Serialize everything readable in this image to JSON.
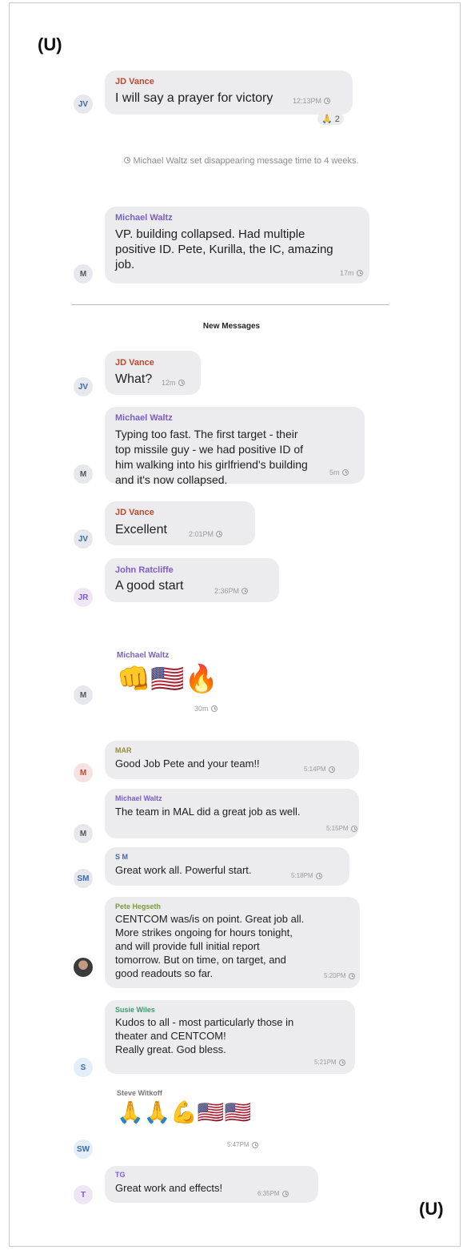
{
  "classification": "(U)",
  "colors": {
    "bubble": "#ececee",
    "jd_vance": "#c0482e",
    "michael_waltz": "#7b5ec8",
    "john_ratcliffe": "#7b5ec8",
    "mar": "#9a8a3c",
    "sm": "#3f6aa8",
    "pete_hegseth": "#7a9a3c",
    "susie_wiles": "#3c9a70",
    "steve_witkoff": "#777777",
    "tg": "#7b5ec8"
  },
  "system_message": "Michael Waltz set disappearing message time to 4 weeks.",
  "new_messages_label": "New Messages",
  "messages": [
    {
      "sender": "JD Vance",
      "avatar": "JV",
      "text": [
        "I will say a prayer for victory"
      ],
      "time": "12:13PM",
      "reaction": {
        "emoji": "🙏",
        "count": "2"
      }
    },
    {
      "sender": "Michael Waltz",
      "avatar": "M",
      "text": [
        "VP.  building collapsed. Had multiple",
        "positive ID. Pete, Kurilla, the IC, amazing",
        "job."
      ],
      "time": "17m"
    },
    {
      "sender": "JD Vance",
      "avatar": "JV",
      "text": [
        "What?"
      ],
      "time": "12m"
    },
    {
      "sender": "Michael Waltz",
      "avatar": "M",
      "text": [
        "Typing too fast. The first target - their",
        "top missile guy - we had positive ID of",
        "him walking into his girlfriend's building",
        "and it's now collapsed."
      ],
      "time": "5m"
    },
    {
      "sender": "JD Vance",
      "avatar": "JV",
      "text": [
        "Excellent"
      ],
      "time": "2:01PM"
    },
    {
      "sender": "John Ratcliffe",
      "avatar": "JR",
      "text": [
        "A good start"
      ],
      "time": "2:36PM"
    },
    {
      "sender": "Michael Waltz",
      "avatar": "M",
      "emojis": "👊🇺🇸🔥",
      "time": "30m"
    },
    {
      "sender": "MAR",
      "avatar": "M",
      "text": [
        "Good Job Pete and your team!!"
      ],
      "time": "5:14PM"
    },
    {
      "sender": "Michael Waltz",
      "avatar": "M",
      "text": [
        "The team in MAL did a great job  as well."
      ],
      "time": "5:15PM"
    },
    {
      "sender": "S M",
      "avatar": "SM",
      "text": [
        "Great work all. Powerful start."
      ],
      "time": "5:18PM"
    },
    {
      "sender": "Pete Hegseth",
      "avatar": "",
      "text": [
        "CENTCOM was/is on point. Great job all.",
        "More strikes ongoing for hours tonight,",
        "and will provide full initial report",
        "tomorrow. But on time, on target, and",
        "good readouts so far."
      ],
      "time": "5:20PM"
    },
    {
      "sender": "Susie Wiles",
      "avatar": "S",
      "text": [
        "Kudos to all - most particularly those in",
        "theater and CENTCOM!",
        "Really great. God bless."
      ],
      "time": "5:21PM"
    },
    {
      "sender": "Steve Witkoff",
      "avatar": "SW",
      "emojis": "🙏🙏💪🇺🇸🇺🇸",
      "time": "5:47PM"
    },
    {
      "sender": "TG",
      "avatar": "T",
      "text": [
        "Great work and effects!"
      ],
      "time": "6:35PM"
    }
  ]
}
